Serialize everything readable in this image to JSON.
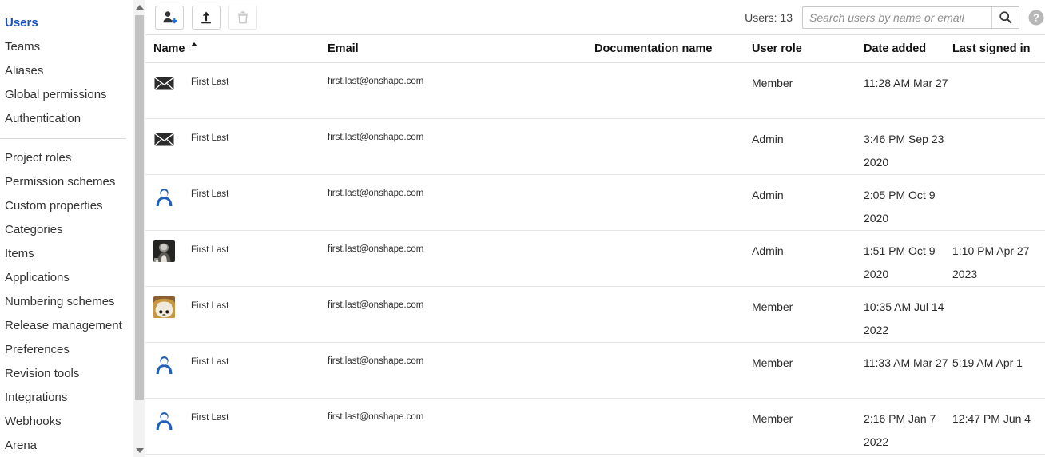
{
  "sidebar": {
    "groups": [
      {
        "items": [
          {
            "label": "Users",
            "active": true
          },
          {
            "label": "Teams",
            "active": false
          },
          {
            "label": "Aliases",
            "active": false
          },
          {
            "label": "Global permissions",
            "active": false
          },
          {
            "label": "Authentication",
            "active": false
          }
        ]
      },
      {
        "items": [
          {
            "label": "Project roles",
            "active": false
          },
          {
            "label": "Permission schemes",
            "active": false
          },
          {
            "label": "Custom properties",
            "active": false
          },
          {
            "label": "Categories",
            "active": false
          },
          {
            "label": "Items",
            "active": false
          },
          {
            "label": "Applications",
            "active": false
          },
          {
            "label": "Numbering schemes",
            "active": false
          },
          {
            "label": "Release management",
            "active": false
          },
          {
            "label": "Preferences",
            "active": false
          },
          {
            "label": "Revision tools",
            "active": false
          },
          {
            "label": "Integrations",
            "active": false
          },
          {
            "label": "Webhooks",
            "active": false
          },
          {
            "label": "Arena",
            "active": false
          }
        ]
      }
    ],
    "scroll_up_icon": "triangle-up-icon",
    "scroll_down_icon": "triangle-down-icon"
  },
  "toolbar": {
    "buttons": [
      {
        "name": "add-user-button",
        "icon": "person-plus-icon",
        "disabled": false
      },
      {
        "name": "upload-users-button",
        "icon": "upload-icon",
        "disabled": false
      },
      {
        "name": "delete-user-button",
        "icon": "trash-icon",
        "disabled": true
      }
    ],
    "users_count_label": "Users: 13",
    "search": {
      "value": "",
      "placeholder": "Search users by name or email",
      "button_icon": "search-icon"
    },
    "help_icon": "help-circle-icon"
  },
  "table": {
    "columns": [
      {
        "label": "Name",
        "sorted": "asc"
      },
      {
        "label": "Email",
        "sorted": ""
      },
      {
        "label": "Documentation name",
        "sorted": ""
      },
      {
        "label": "User role",
        "sorted": ""
      },
      {
        "label": "Date added",
        "sorted": ""
      },
      {
        "label": "Last signed in",
        "sorted": ""
      }
    ],
    "rows": [
      {
        "avatar": "envelope-icon",
        "name": "First Last",
        "email": "first.last@onshape.com",
        "documentation_name": "",
        "user_role": "Member",
        "date_added": "11:28 AM Mar 27",
        "last_signed_in": ""
      },
      {
        "avatar": "envelope-icon",
        "name": "First Last",
        "email": "first.last@onshape.com",
        "documentation_name": "",
        "user_role": "Admin",
        "date_added": "3:46 PM Sep 23 2020",
        "last_signed_in": ""
      },
      {
        "avatar": "default-avatar-icon",
        "name": "First Last",
        "email": "first.last@onshape.com",
        "documentation_name": "",
        "user_role": "Admin",
        "date_added": "2:05 PM Oct 9 2020",
        "last_signed_in": ""
      },
      {
        "avatar": "photo-avatar-dark",
        "name": "First Last",
        "email": "first.last@onshape.com",
        "documentation_name": "",
        "user_role": "Admin",
        "date_added": "1:51 PM Oct 9 2020",
        "last_signed_in": "1:10 PM Apr 27 2023"
      },
      {
        "avatar": "photo-avatar-tan",
        "name": "First Last",
        "email": "first.last@onshape.com",
        "documentation_name": "",
        "user_role": "Member",
        "date_added": "10:35 AM Jul 14 2022",
        "last_signed_in": ""
      },
      {
        "avatar": "default-avatar-icon",
        "name": "First Last",
        "email": "first.last@onshape.com",
        "documentation_name": "",
        "user_role": "Member",
        "date_added": "11:33 AM Mar 27",
        "last_signed_in": "5:19 AM Apr 1"
      },
      {
        "avatar": "default-avatar-icon",
        "name": "First Last",
        "email": "first.last@onshape.com",
        "documentation_name": "",
        "user_role": "Member",
        "date_added": "2:16 PM Jan 7 2022",
        "last_signed_in": "12:47 PM Jun 4"
      }
    ]
  },
  "colors": {
    "accent_blue": "#1a53c0",
    "avatar_blue": "#1f5fba",
    "plus_blue": "#1f6fe0",
    "border": "#e4e4e4",
    "text": "#2b2b2b",
    "muted": "#8d8d8d"
  }
}
